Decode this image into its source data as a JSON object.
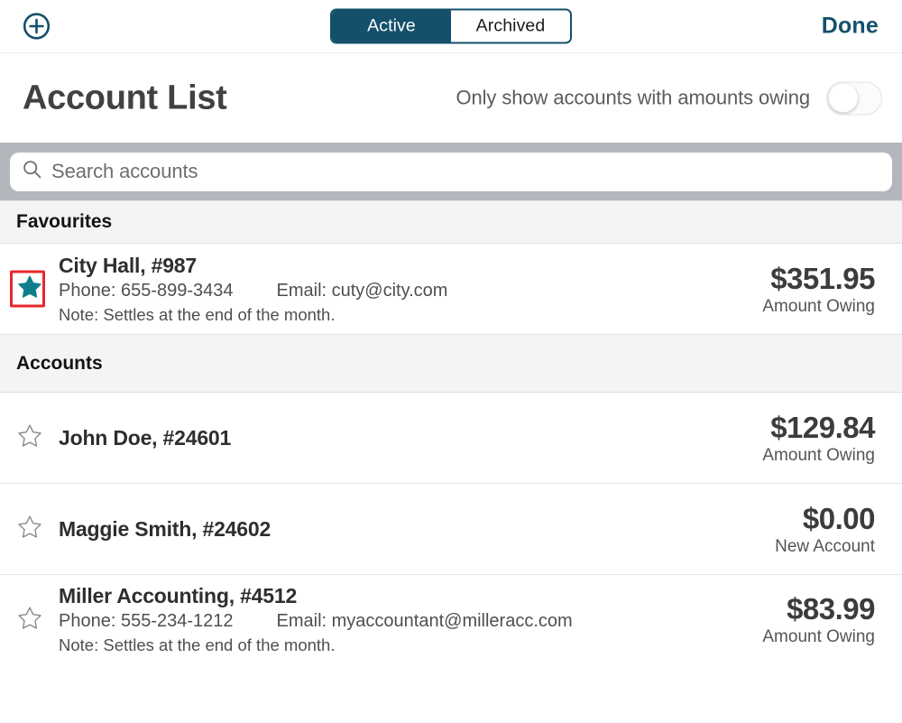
{
  "topbar": {
    "add_icon": "plus-circle-icon",
    "segments": [
      {
        "label": "Active",
        "selected": true
      },
      {
        "label": "Archived",
        "selected": false
      }
    ],
    "done_label": "Done",
    "accent_color": "#14506b"
  },
  "header": {
    "title": "Account List",
    "toggle_label": "Only show accounts with amounts owing",
    "toggle_state": "off"
  },
  "search": {
    "icon": "search-icon",
    "placeholder": "Search accounts",
    "value": ""
  },
  "sections": [
    {
      "header": "Favourites",
      "rows": [
        {
          "star": "star-filled-icon",
          "starred": true,
          "highlighted": true,
          "highlight_color": "#e8272d",
          "star_color": "#0f7d8c",
          "name": "City Hall, #987",
          "phone": "Phone: 655-899-3434",
          "email": "Email: cuty@city.com",
          "note": "Note: Settles at the end of the month.",
          "amount": "$351.95",
          "amount_label": "Amount Owing"
        }
      ]
    },
    {
      "header": "Accounts",
      "rows": [
        {
          "star": "star-outline-icon",
          "starred": false,
          "highlighted": false,
          "name": "John Doe, #24601",
          "phone": "",
          "email": "",
          "note": "",
          "amount": "$129.84",
          "amount_label": "Amount Owing"
        },
        {
          "star": "star-outline-icon",
          "starred": false,
          "highlighted": false,
          "name": "Maggie Smith, #24602",
          "phone": "",
          "email": "",
          "note": "",
          "amount": "$0.00",
          "amount_label": "New Account"
        },
        {
          "star": "star-outline-icon",
          "starred": false,
          "highlighted": false,
          "name": "Miller Accounting, #4512",
          "phone": "Phone: 555-234-1212",
          "email": "Email: myaccountant@milleracc.com",
          "note": "Note: Settles at the end of the month.",
          "amount": "$83.99",
          "amount_label": "Amount Owing"
        }
      ]
    }
  ]
}
